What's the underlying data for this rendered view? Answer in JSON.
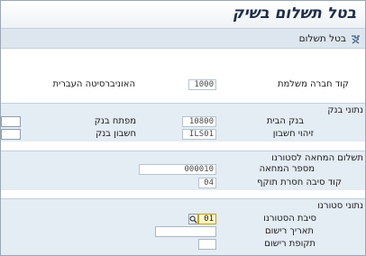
{
  "window": {
    "title": "בטל תשלום בשיק"
  },
  "toolbar": {
    "cancel_payment_label": "בטל תשלום",
    "cancel_payment_icon": "cancel-payment-icon"
  },
  "company": {
    "paying_company_label": "קוד חברה משלמת",
    "paying_company_value": "1000",
    "company_name": "האוניברסיטה העברית"
  },
  "bank_data": {
    "section_title": "נתוני בנק",
    "house_bank_label": "בנק הבית",
    "house_bank_value": "10800",
    "account_id_label": "זיהוי חשבון",
    "account_id_value": "ILS01",
    "bank_key_label": "מפתח בנק",
    "bank_key_value": "",
    "bank_account_label": "חשבון בנק",
    "bank_account_value": ""
  },
  "check_reversal": {
    "section_title": "תשלום המחאה לסטורנו",
    "check_number_label": "מספר המחאה",
    "check_number_value": "000010",
    "void_reason_label": "קוד סיבה חסרת תוקף",
    "void_reason_value": "04"
  },
  "reversal_data": {
    "section_title": "נתוני סטורנו",
    "reversal_reason_label": "סיבת הסטורנו",
    "reversal_reason_value": "01",
    "posting_date_label": "תאריך רישום",
    "posting_date_value": "",
    "posting_period_label": "תקופת רישום",
    "posting_period_value": ""
  },
  "colors": {
    "toolbar_bg": "#dde6ef",
    "section_bg": "#e4ecf4",
    "required_field_bg": "#fff6cc",
    "title_color": "#1f2f4a"
  }
}
